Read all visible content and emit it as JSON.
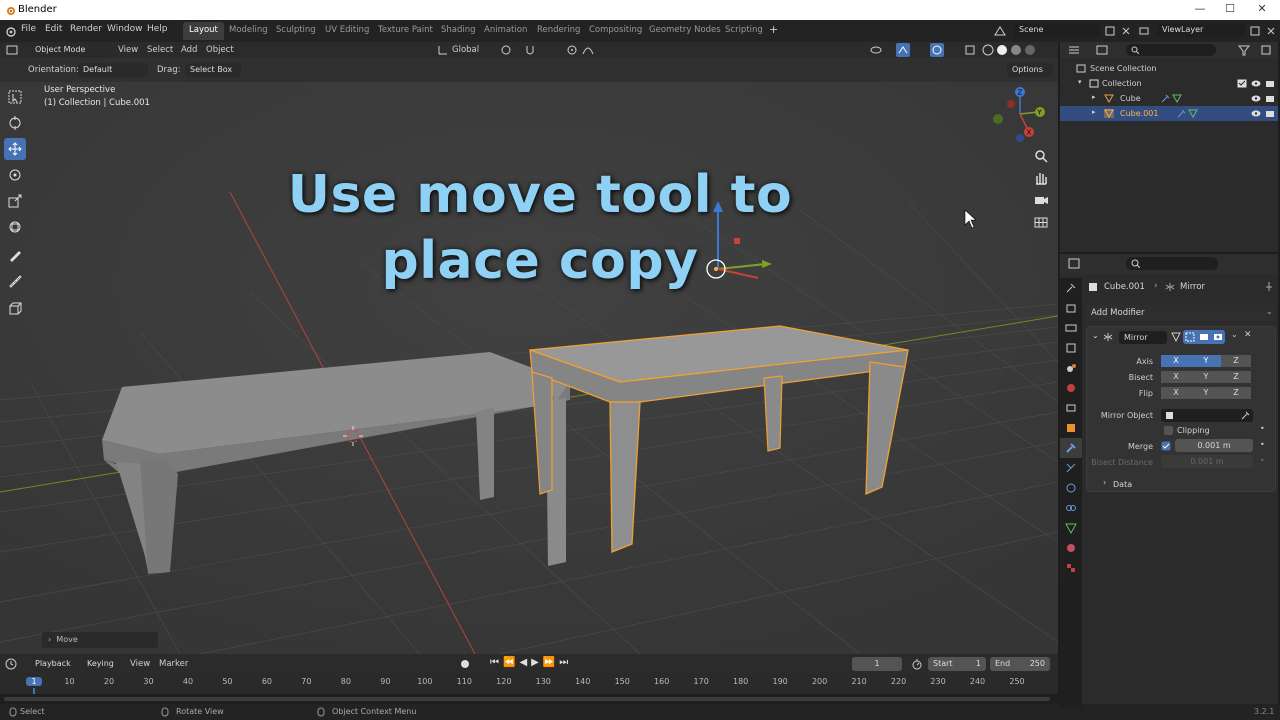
{
  "window": {
    "title": "Blender",
    "controls": [
      "—",
      "☐",
      "✕"
    ]
  },
  "menus": [
    "File",
    "Edit",
    "Render",
    "Window",
    "Help"
  ],
  "workspaces": [
    {
      "label": "Layout",
      "active": true
    },
    {
      "label": "Modeling"
    },
    {
      "label": "Sculpting"
    },
    {
      "label": "UV Editing"
    },
    {
      "label": "Texture Paint"
    },
    {
      "label": "Shading"
    },
    {
      "label": "Animation"
    },
    {
      "label": "Rendering"
    },
    {
      "label": "Compositing"
    },
    {
      "label": "Geometry Nodes"
    },
    {
      "label": "Scripting"
    }
  ],
  "add_workspace": "+",
  "scene": {
    "label": "Scene",
    "view_layer": "ViewLayer"
  },
  "viewport_header": {
    "mode": "Object Mode",
    "menus": [
      "View",
      "Select",
      "Add",
      "Object"
    ],
    "transform": "Global"
  },
  "tool_header": {
    "orientation_label": "Orientation:",
    "orientation_value": "Default",
    "drag_label": "Drag:",
    "drag_value": "Select Box",
    "options": "Options"
  },
  "viewport": {
    "perspective": "User Perspective",
    "collection_info": "(1) Collection | Cube.001",
    "overlay_line1": "Use move tool to",
    "overlay_line2": "place copy",
    "last_op": "Move"
  },
  "outliner": {
    "root": "Scene Collection",
    "collection": "Collection",
    "items": [
      "Cube",
      "Cube.001"
    ],
    "selected": "Cube.001"
  },
  "properties": {
    "object": "Cube.001",
    "modifier_crumb": "Mirror",
    "add_modifier": "Add Modifier",
    "modifier_name": "Mirror",
    "axis_label": "Axis",
    "bisect_label": "Bisect",
    "flip_label": "Flip",
    "x": "X",
    "y": "Y",
    "z": "Z",
    "mirror_object_label": "Mirror Object",
    "clipping_label": "Clipping",
    "merge_label": "Merge",
    "merge_value": "0.001 m",
    "bisect_distance_label": "Bisect Distance",
    "bisect_distance_value": "0.001 m",
    "data_label": "Data",
    "axis_state": {
      "x": true,
      "y": true,
      "z": false
    }
  },
  "timeline": {
    "menus": [
      "Playback",
      "Keying",
      "View",
      "Marker"
    ],
    "current_frame": "1",
    "start_label": "Start",
    "start_value": "1",
    "end_label": "End",
    "end_value": "250",
    "ruler_ticks": [
      "1",
      "10",
      "20",
      "30",
      "40",
      "50",
      "60",
      "70",
      "80",
      "90",
      "100",
      "110",
      "120",
      "130",
      "140",
      "150",
      "160",
      "170",
      "180",
      "190",
      "200",
      "210",
      "220",
      "230",
      "240",
      "250"
    ]
  },
  "statusbar": {
    "select": "Select",
    "rotate_view": "Rotate View",
    "context_menu": "Object Context Menu",
    "version": "3.2.1"
  },
  "colors": {
    "accent": "#4772b3",
    "selection_outline": "#f0a030",
    "overlay_text": "#8fd1f5",
    "x_axis": "#c8413a",
    "y_axis": "#7ea027",
    "z_axis": "#3d7ad6"
  }
}
